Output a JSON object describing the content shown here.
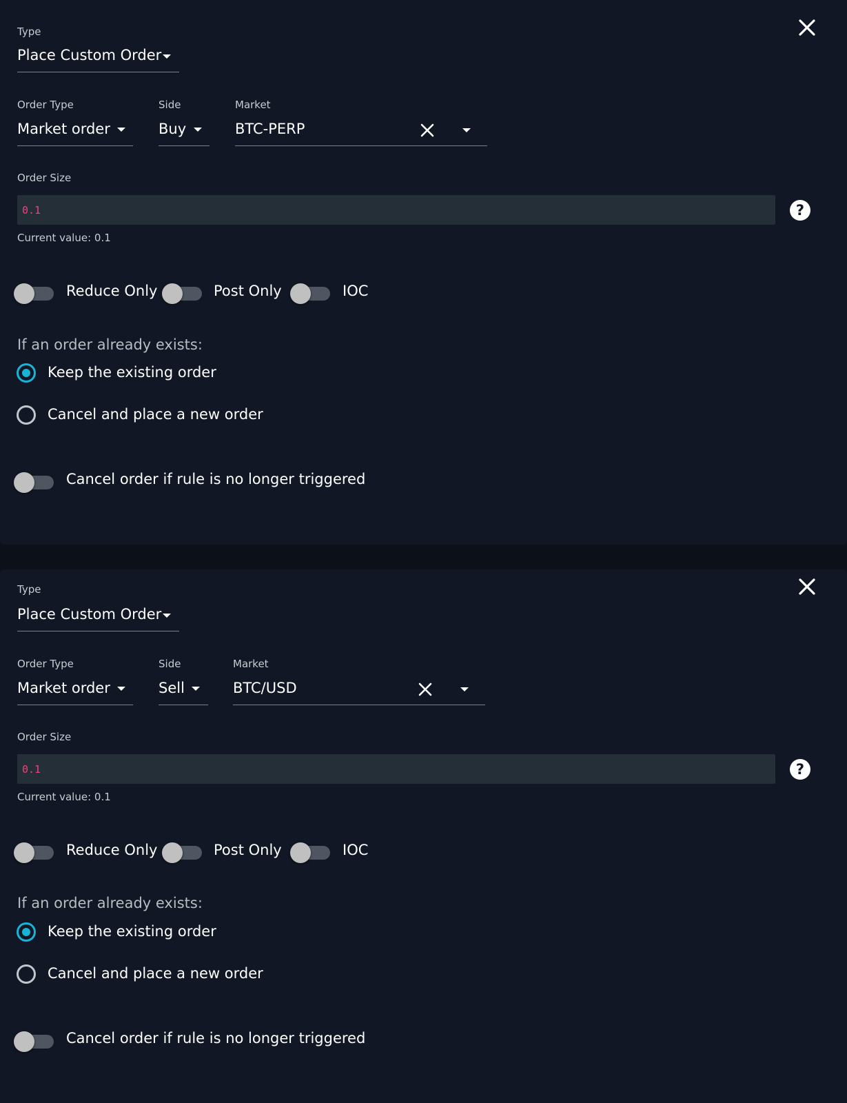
{
  "panels": [
    {
      "type_label": "Type",
      "type_value": "Place Custom Order",
      "order_type_label": "Order Type",
      "order_type_value": "Market order",
      "side_label": "Side",
      "side_value": "Buy",
      "market_label": "Market",
      "market_value": "BTC-PERP",
      "order_size_label": "Order Size",
      "order_size_value": "0.1",
      "order_size_helper": "Current value: 0.1",
      "help_glyph": "?",
      "toggles": [
        {
          "label": "Reduce Only",
          "on": false
        },
        {
          "label": "Post Only",
          "on": false
        },
        {
          "label": "IOC",
          "on": false
        }
      ],
      "existing_title": "If an order already exists:",
      "radio_options": [
        {
          "label": "Keep the existing order",
          "checked": true
        },
        {
          "label": "Cancel and place a new order",
          "checked": false
        }
      ],
      "cancel_toggle": {
        "label": "Cancel order if rule is no longer triggered",
        "on": false
      }
    },
    {
      "type_label": "Type",
      "type_value": "Place Custom Order",
      "order_type_label": "Order Type",
      "order_type_value": "Market order",
      "side_label": "Side",
      "side_value": "Sell",
      "market_label": "Market",
      "market_value": "BTC/USD",
      "order_size_label": "Order Size",
      "order_size_value": "0.1",
      "order_size_helper": "Current value: 0.1",
      "help_glyph": "?",
      "toggles": [
        {
          "label": "Reduce Only",
          "on": false
        },
        {
          "label": "Post Only",
          "on": false
        },
        {
          "label": "IOC",
          "on": false
        }
      ],
      "existing_title": "If an order already exists:",
      "radio_options": [
        {
          "label": "Keep the existing order",
          "checked": true
        },
        {
          "label": "Cancel and place a new order",
          "checked": false
        }
      ],
      "cancel_toggle": {
        "label": "Cancel order if rule is no longer triggered",
        "on": false
      }
    }
  ],
  "colors": {
    "accent": "#19b3d6",
    "input_text": "#e8467a",
    "background": "#111724"
  },
  "icons": [
    "close-icon",
    "clear-icon",
    "dropdown-arrow-icon",
    "help-icon"
  ]
}
